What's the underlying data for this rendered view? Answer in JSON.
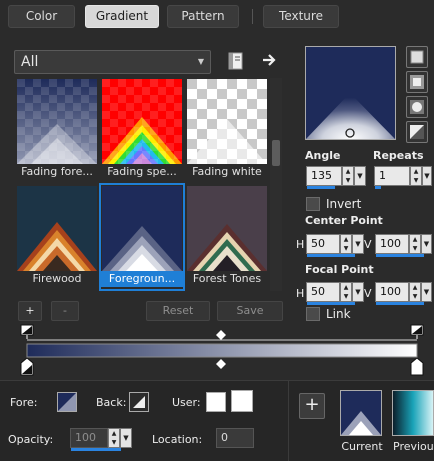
{
  "tabs": [
    {
      "label": "Color",
      "active": false
    },
    {
      "label": "Gradient",
      "active": true
    },
    {
      "label": "Pattern",
      "active": false
    },
    {
      "label": "Texture",
      "active": false
    }
  ],
  "category": {
    "selected": "All"
  },
  "presets": [
    {
      "name": "Fading fore...",
      "selected": false
    },
    {
      "name": "Fading spe...",
      "selected": false
    },
    {
      "name": "Fading white",
      "selected": false
    },
    {
      "name": "Firewood",
      "selected": false
    },
    {
      "name": "Foregroun...",
      "selected": true
    },
    {
      "name": "Forest Tones",
      "selected": false
    }
  ],
  "preset_buttons": {
    "add": "+",
    "remove": "-",
    "reset": "Reset",
    "save": "Save"
  },
  "settings": {
    "angle_label": "Angle",
    "angle_value": "135",
    "repeats_label": "Repeats",
    "repeats_value": "1",
    "invert_label": "Invert",
    "center_point_label": "Center Point",
    "center_h_label": "H",
    "center_h_value": "50",
    "center_v_label": "V",
    "center_v_value": "100",
    "focal_point_label": "Focal Point",
    "focal_h_label": "H",
    "focal_h_value": "50",
    "focal_v_label": "V",
    "focal_v_value": "100",
    "link_label": "Link"
  },
  "bottom": {
    "fore_label": "Fore:",
    "back_label": "Back:",
    "user_label": "User:",
    "opacity_label": "Opacity:",
    "opacity_value": "100",
    "location_label": "Location:",
    "location_value": "0",
    "add_label": "+",
    "current_label": "Current",
    "previous_label": "Previou"
  },
  "colors": {
    "accent": "#1f7fd6",
    "foreground": "#1e2b5a",
    "background": "#ffffff"
  }
}
